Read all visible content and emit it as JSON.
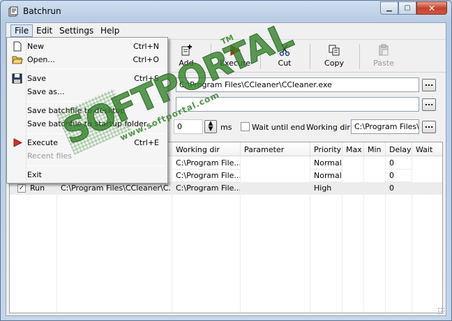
{
  "window": {
    "title": "Batchrun"
  },
  "menubar": {
    "items": [
      "File",
      "Edit",
      "Settings",
      "Help"
    ]
  },
  "file_menu": {
    "items": [
      {
        "label": "New",
        "shortcut": "Ctrl+N",
        "icon": "new-document-icon",
        "enabled": true
      },
      {
        "label": "Open...",
        "shortcut": "Ctrl+O",
        "icon": "open-folder-icon",
        "enabled": true
      },
      {
        "label": "Save",
        "shortcut": "Ctrl+S",
        "icon": "save-disk-icon",
        "enabled": true
      },
      {
        "label": "Save as...",
        "shortcut": "",
        "icon": "",
        "enabled": true
      },
      {
        "label": "Save batchfile to desktop",
        "shortcut": "",
        "icon": "",
        "enabled": true
      },
      {
        "label": "Save batchfile to startup folder...",
        "shortcut": "",
        "icon": "",
        "enabled": true
      },
      {
        "label": "Execute",
        "shortcut": "Ctrl+E",
        "icon": "execute-arrow-icon",
        "enabled": true
      },
      {
        "label": "Recent files",
        "shortcut": "",
        "icon": "",
        "enabled": false
      },
      {
        "label": "Exit",
        "shortcut": "",
        "icon": "",
        "enabled": true
      }
    ]
  },
  "toolbar": {
    "buttons": [
      {
        "label": "Add",
        "icon": "add-icon",
        "enabled": true
      },
      {
        "label": "Execute",
        "icon": "execute-icon",
        "enabled": true
      },
      {
        "label": "Cut",
        "icon": "scissors-icon",
        "enabled": true
      },
      {
        "label": "Copy",
        "icon": "copy-icon",
        "enabled": true
      },
      {
        "label": "Paste",
        "icon": "paste-icon",
        "enabled": false
      }
    ]
  },
  "form": {
    "program_path": "C:\\Program Files\\CCleaner\\CCleaner.exe",
    "parameter": "",
    "delay_value": "0",
    "delay_unit": "ms",
    "wait_until_end_label": "Wait until end",
    "wait_until_end_checked": false,
    "working_dir_label": "Working dir",
    "working_dir_value": "C:\\Program Files\\CC",
    "browse_label": "..."
  },
  "table": {
    "columns": [
      "",
      "",
      "Working dir",
      "Parameter",
      "Priority",
      "Max",
      "Min",
      "Delay",
      "Wait"
    ],
    "rows": [
      {
        "checked": false,
        "action": "",
        "program": "",
        "working_dir": "C:\\Program File...",
        "parameter": "",
        "priority": "Normal",
        "max": "",
        "min": "",
        "delay": "0",
        "wait": ""
      },
      {
        "checked": false,
        "action": "",
        "program": "",
        "working_dir": "C:\\Program File...",
        "parameter": "",
        "priority": "Normal",
        "max": "",
        "min": "",
        "delay": "0",
        "wait": ""
      },
      {
        "checked": true,
        "action": "Run",
        "program": "C:\\Program Files\\CCleaner\\C...",
        "working_dir": "C:\\Program File...",
        "parameter": "",
        "priority": "High",
        "max": "",
        "min": "",
        "delay": "0",
        "wait": ""
      }
    ]
  },
  "watermark": {
    "brand": "SOFTPORTAL",
    "trademark": "TM",
    "url": "www.softportal.com"
  },
  "colors": {
    "watermark_green": "#328228",
    "execute_red": "#d0321e",
    "menu_highlight": "#dce6f4"
  }
}
